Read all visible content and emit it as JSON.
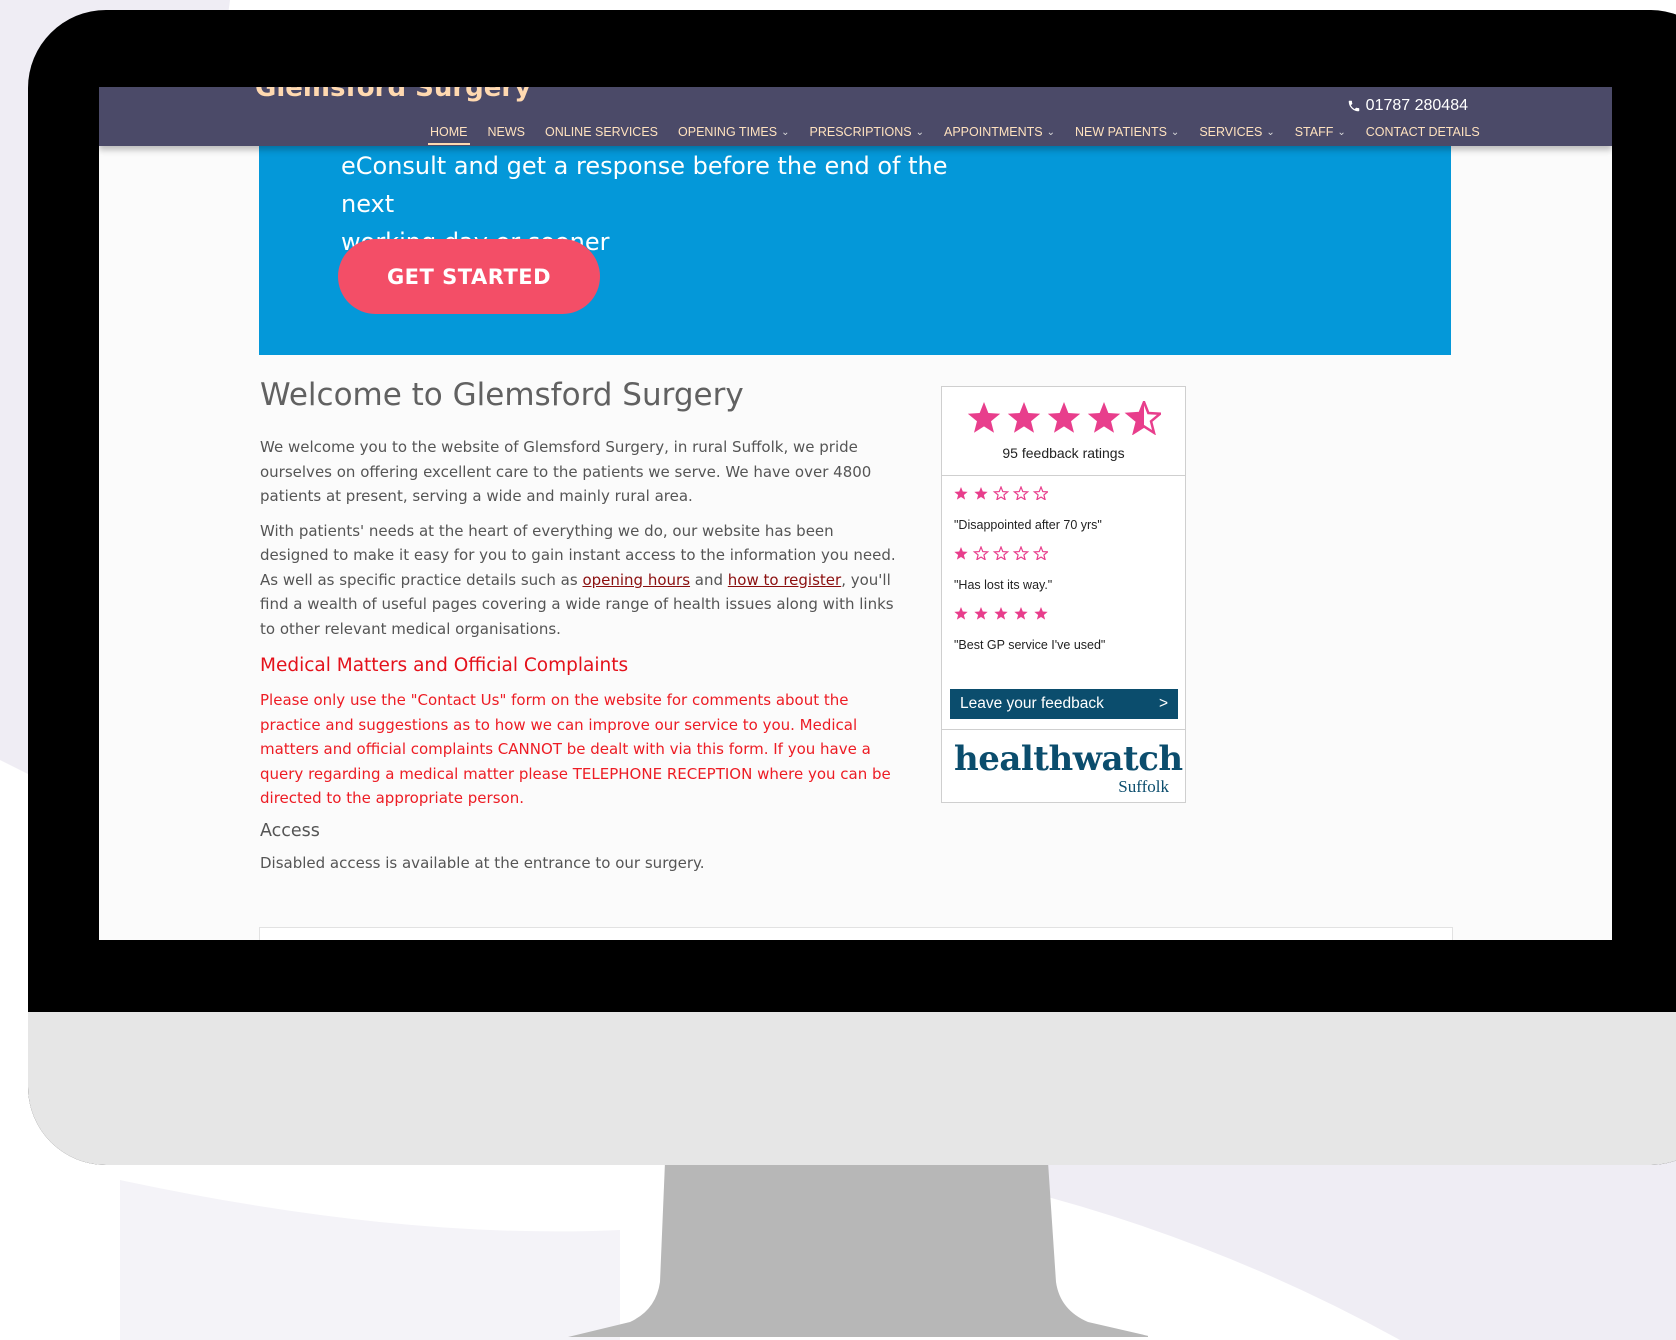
{
  "site": {
    "brand": "Glemsford Surgery",
    "phone": "01787 280484",
    "nav": [
      {
        "label": "HOME",
        "dropdown": false,
        "active": true
      },
      {
        "label": "NEWS",
        "dropdown": false
      },
      {
        "label": "ONLINE SERVICES",
        "dropdown": false
      },
      {
        "label": "OPENING TIMES",
        "dropdown": true
      },
      {
        "label": "PRESCRIPTIONS",
        "dropdown": true
      },
      {
        "label": "APPOINTMENTS",
        "dropdown": true
      },
      {
        "label": "NEW PATIENTS",
        "dropdown": true
      },
      {
        "label": "SERVICES",
        "dropdown": true
      },
      {
        "label": "STAFF",
        "dropdown": true
      },
      {
        "label": "CONTACT DETAILS",
        "dropdown": false
      }
    ]
  },
  "hero": {
    "line1": "eConsult and get a response before the end of the next",
    "line2": "working day or sooner",
    "button": "GET STARTED"
  },
  "main": {
    "title": "Welcome to Glemsford Surgery",
    "para1": "We welcome you to the website of Glemsford Surgery, in rural Suffolk, we pride ourselves on offering excellent care to the patients we serve. We have over 4800 patients at present, serving a wide and mainly rural area.",
    "para2_a": "With patients' needs at the heart of everything we do, our website has been designed to make it easy for you to gain instant access to the information you need. As well as specific practice details such as ",
    "link_opening": "opening hours",
    "para2_b": " and ",
    "link_register": "how to register",
    "para2_c": ", you'll find a wealth of useful pages covering a wide range of health issues along with links to other relevant medical organisations.",
    "complaints_heading": "Medical Matters and Official Complaints",
    "complaints_text": "Please only use the \"Contact Us\" form on the website for comments about the practice and suggestions as to how we can improve our service to you.  Medical matters and official complaints CANNOT be dealt with via this form.  If you have a query regarding a medical matter please TELEPHONE RECEPTION where you can be directed to the appropriate person.",
    "access_heading": "Access",
    "access_text": "Disabled access is available at the entrance to our surgery."
  },
  "widget": {
    "overall_rating": 4.5,
    "ratings_count": "95 feedback ratings",
    "reviews": [
      {
        "stars": 2,
        "text": "\"Disappointed after 70 yrs\""
      },
      {
        "stars": 1,
        "text": "\"Has lost its way.\""
      },
      {
        "stars": 5,
        "text": "\"Best GP service I've used\""
      }
    ],
    "leave_feedback": "Leave your feedback",
    "leave_arrow": ">",
    "logo_word": "healthwatch",
    "logo_sub": "Suffolk",
    "star_color": "#e83e8c"
  }
}
